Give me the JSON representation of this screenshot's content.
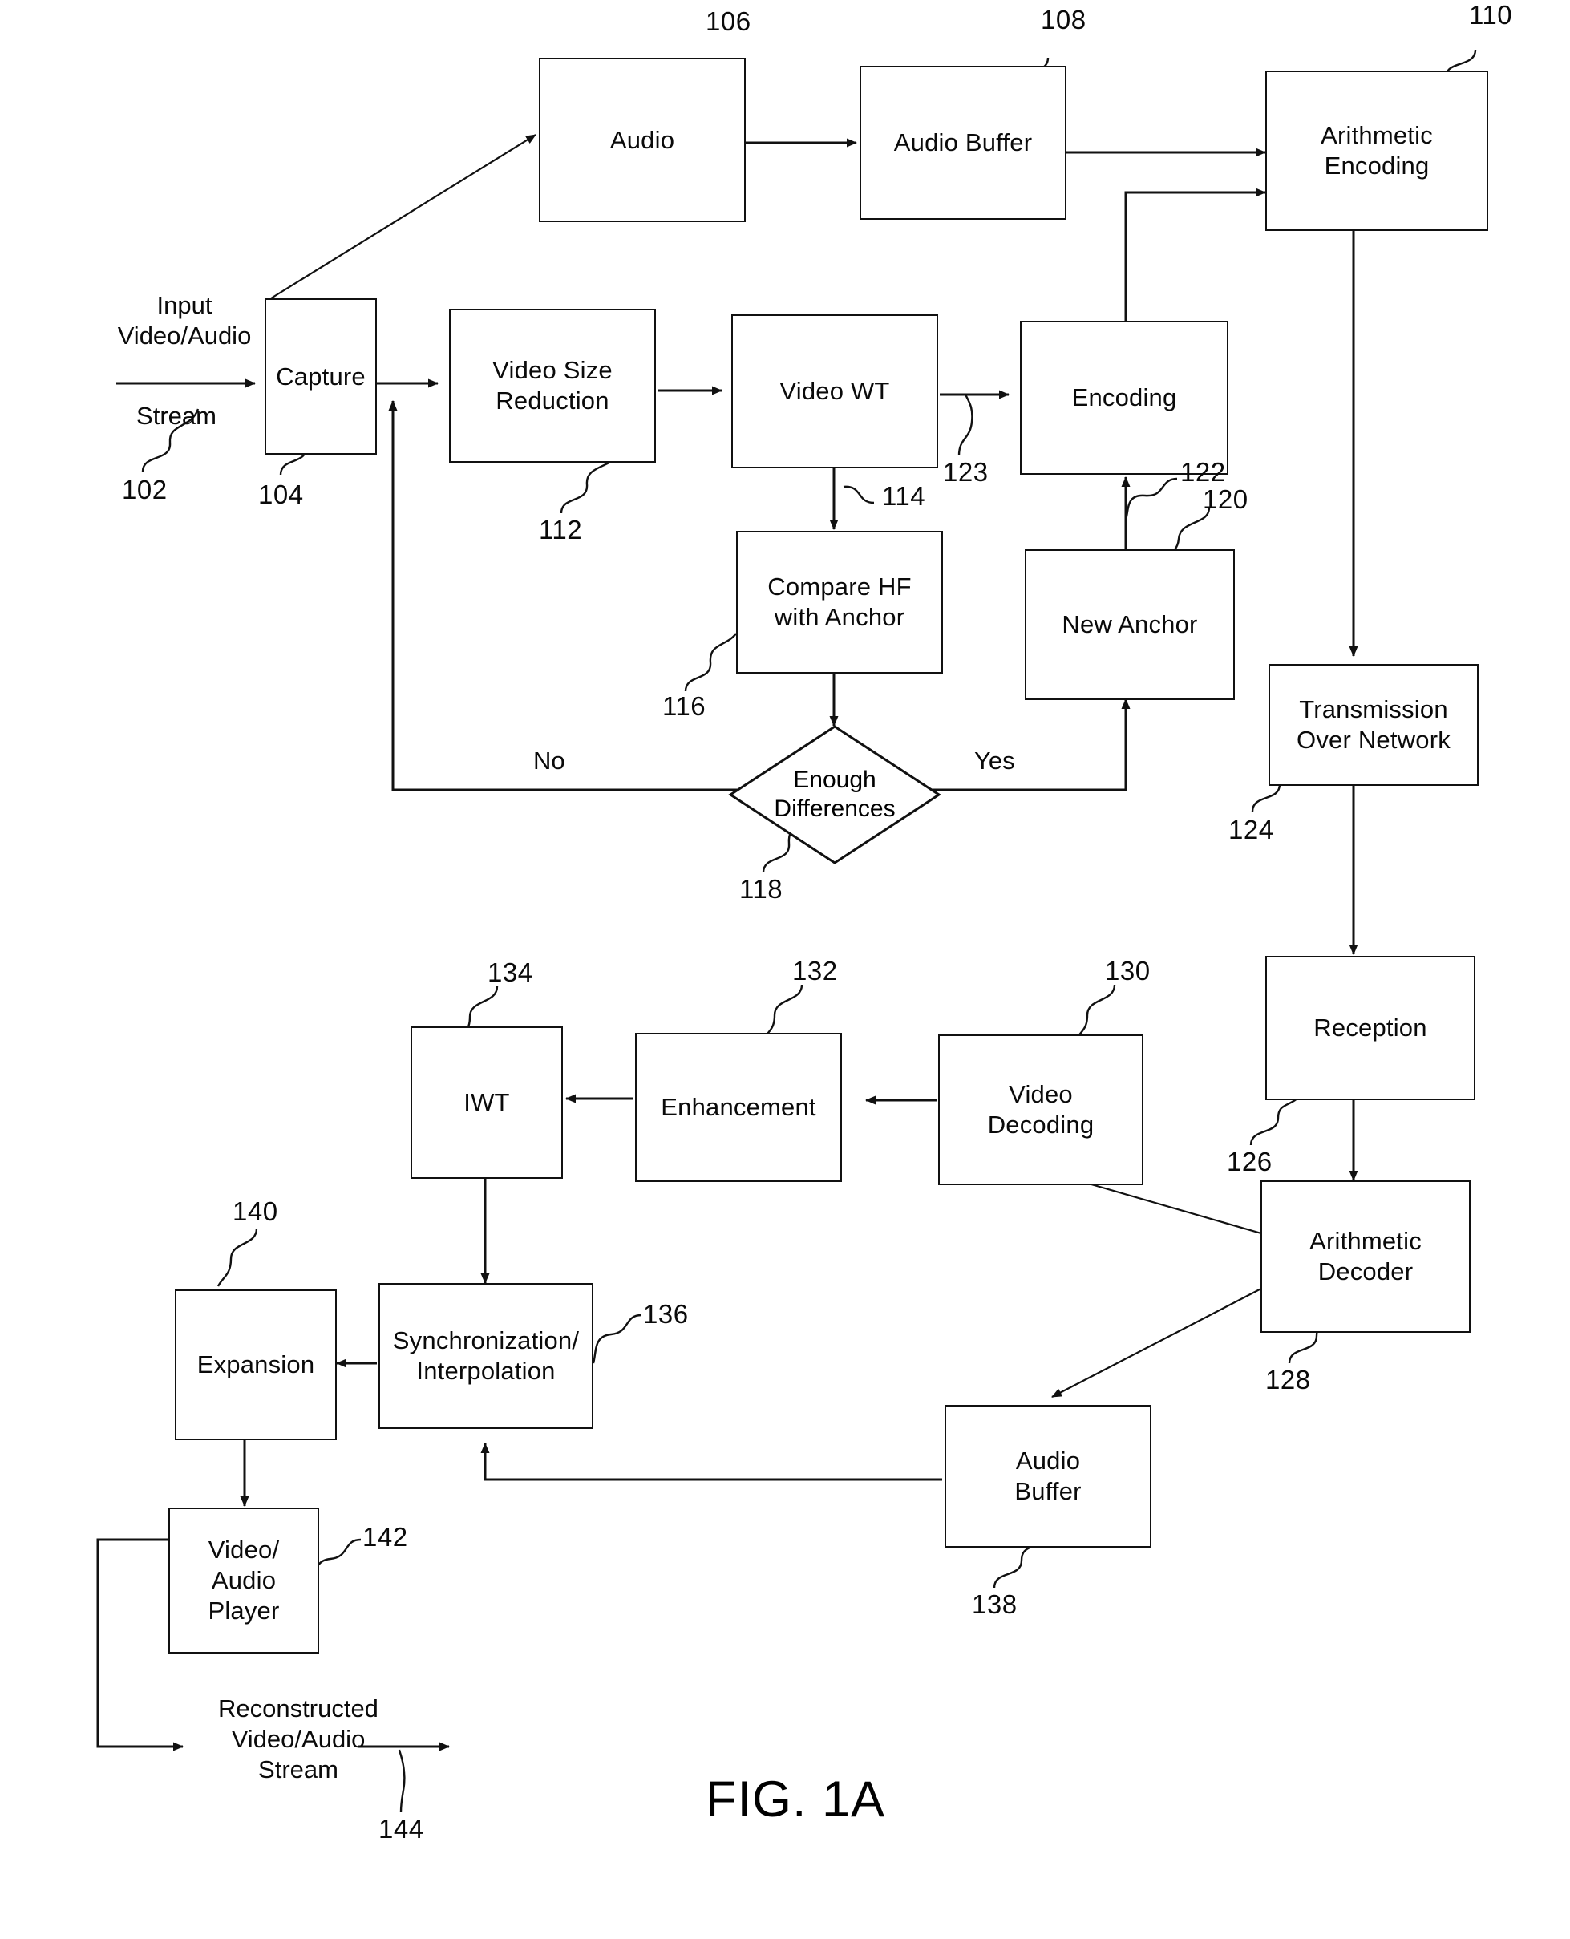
{
  "figure": {
    "label": "FIG. 1A",
    "title": "Video/Audio compression, transmission and reconstruction block diagram"
  },
  "colors": {
    "ink": "#111111",
    "background": "#ffffff"
  },
  "blocks": [
    {
      "id": "capture",
      "label": "Capture",
      "ref": "104"
    },
    {
      "id": "audio",
      "label": "Audio",
      "ref": "106"
    },
    {
      "id": "audio_buffer",
      "label": "Audio Buffer",
      "ref": "108"
    },
    {
      "id": "arith_enc",
      "label": "Arithmetic\nEncoding",
      "ref": "110"
    },
    {
      "id": "size_reduce",
      "label": "Video Size\nReduction",
      "ref": "112"
    },
    {
      "id": "video_wt",
      "label": "Video WT",
      "ref": ""
    },
    {
      "id": "encoding",
      "label": "Encoding",
      "ref": ""
    },
    {
      "id": "compare_hf",
      "label": "Compare HF\nwith Anchor",
      "ref": "116"
    },
    {
      "id": "new_anchor",
      "label": "New Anchor",
      "ref": "120"
    },
    {
      "id": "enough_diff",
      "label": "Enough\nDifferences",
      "ref": "118"
    },
    {
      "id": "transmission",
      "label": "Transmission\nOver Network",
      "ref": "124"
    },
    {
      "id": "reception",
      "label": "Reception",
      "ref": "126"
    },
    {
      "id": "arith_dec",
      "label": "Arithmetic\nDecoder",
      "ref": "128"
    },
    {
      "id": "video_decode",
      "label": "Video\nDecoding",
      "ref": "130"
    },
    {
      "id": "enhancement",
      "label": "Enhancement",
      "ref": "132"
    },
    {
      "id": "iwt",
      "label": "IWT",
      "ref": "134"
    },
    {
      "id": "sync_interp",
      "label": "Synchronization/\nInterpolation",
      "ref": "136"
    },
    {
      "id": "expansion",
      "label": "Expansion",
      "ref": "140"
    },
    {
      "id": "av_player",
      "label": "Video/\nAudio\nPlayer",
      "ref": "142"
    },
    {
      "id": "audio_buffer2",
      "label": "Audio\nBuffer",
      "ref": "138"
    }
  ],
  "free_text": {
    "input_stream": "Input\nVideo/Audio",
    "input_stream2": "Stream",
    "reconstructed": "Reconstructed\nVideo/Audio\nStream",
    "no_label": "No",
    "yes_label": "Yes"
  },
  "reference_numerals": {
    "n102": "102",
    "n104": "104",
    "n106": "106",
    "n108": "108",
    "n110": "110",
    "n112": "112",
    "n114": "114",
    "n116": "116",
    "n118": "118",
    "n120": "120",
    "n122": "122",
    "n123": "123",
    "n124": "124",
    "n126": "126",
    "n128": "128",
    "n130": "130",
    "n132": "132",
    "n134": "134",
    "n136": "136",
    "n138": "138",
    "n140": "140",
    "n142": "142",
    "n144": "144"
  }
}
